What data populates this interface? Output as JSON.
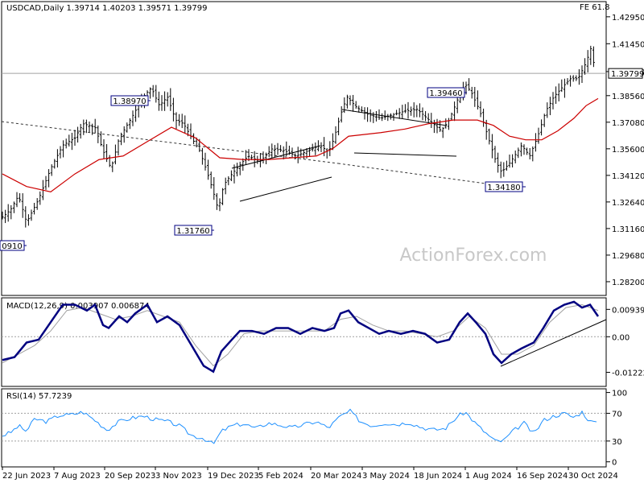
{
  "header": {
    "symbol_info": "USDCAD,Daily  1.39714 1.40203 1.39571 1.39799",
    "indicator": "FE 61.8"
  },
  "watermark": "ActionForex.com",
  "colors": {
    "price_bars": "#000000",
    "ma": "#cc0000",
    "macd_main": "#000080",
    "macd_signal": "#a0a0a0",
    "rsi": "#1e90ff",
    "levels": "#a0a0a0",
    "label_border": "#000080",
    "watermark": "#c8c8c8"
  },
  "chart_data": [
    {
      "type": "line",
      "name": "price-panel",
      "title": "USDCAD,Daily",
      "ylim": [
        1.2748,
        1.4375
      ],
      "yticks": [
        "1.42950",
        "1.41450",
        "1.39900",
        "1.38560",
        "1.37080",
        "1.35600",
        "1.34120",
        "1.32640",
        "1.31160",
        "1.29680",
        "1.28200"
      ],
      "ytick_values": [
        1.4295,
        1.4145,
        1.399,
        1.3856,
        1.3708,
        1.356,
        1.3412,
        1.3264,
        1.3116,
        1.2968,
        1.282
      ],
      "current_price_label": "1.39799",
      "current_price": 1.39799,
      "x_labels": [
        "22 Jun 2023",
        "7 Aug 2023",
        "20 Sep 2023",
        "3 Nov 2023",
        "19 Dec 2023",
        "5 Feb 2024",
        "20 Mar 2024",
        "3 May 2024",
        "18 Jun 2024",
        "1 Aug 2024",
        "16 Sep 2024",
        "30 Oct 2024"
      ],
      "close_path": [
        [
          0,
          1.318
        ],
        [
          10,
          1.322
        ],
        [
          20,
          1.33
        ],
        [
          30,
          1.315
        ],
        [
          45,
          1.328
        ],
        [
          60,
          1.345
        ],
        [
          75,
          1.358
        ],
        [
          90,
          1.362
        ],
        [
          100,
          1.37
        ],
        [
          115,
          1.368
        ],
        [
          125,
          1.355
        ],
        [
          135,
          1.345
        ],
        [
          145,
          1.362
        ],
        [
          160,
          1.373
        ],
        [
          175,
          1.385
        ],
        [
          185,
          1.39
        ],
        [
          195,
          1.38
        ],
        [
          205,
          1.385
        ],
        [
          215,
          1.372
        ],
        [
          225,
          1.37
        ],
        [
          235,
          1.362
        ],
        [
          245,
          1.355
        ],
        [
          255,
          1.342
        ],
        [
          262,
          1.332
        ],
        [
          268,
          1.322
        ],
        [
          275,
          1.336
        ],
        [
          285,
          1.342
        ],
        [
          295,
          1.347
        ],
        [
          305,
          1.352
        ],
        [
          320,
          1.349
        ],
        [
          335,
          1.356
        ],
        [
          350,
          1.355
        ],
        [
          365,
          1.352
        ],
        [
          380,
          1.355
        ],
        [
          395,
          1.358
        ],
        [
          405,
          1.354
        ],
        [
          412,
          1.362
        ],
        [
          420,
          1.375
        ],
        [
          428,
          1.385
        ],
        [
          440,
          1.379
        ],
        [
          455,
          1.375
        ],
        [
          470,
          1.373
        ],
        [
          485,
          1.375
        ],
        [
          500,
          1.377
        ],
        [
          515,
          1.378
        ],
        [
          530,
          1.372
        ],
        [
          545,
          1.366
        ],
        [
          555,
          1.372
        ],
        [
          565,
          1.383
        ],
        [
          575,
          1.392
        ],
        [
          583,
          1.387
        ],
        [
          593,
          1.377
        ],
        [
          603,
          1.363
        ],
        [
          613,
          1.349
        ],
        [
          620,
          1.343
        ],
        [
          630,
          1.348
        ],
        [
          645,
          1.358
        ],
        [
          655,
          1.352
        ],
        [
          665,
          1.363
        ],
        [
          675,
          1.377
        ],
        [
          685,
          1.385
        ],
        [
          695,
          1.39
        ],
        [
          705,
          1.395
        ],
        [
          715,
          1.395
        ],
        [
          725,
          1.404
        ],
        [
          731,
          1.412
        ],
        [
          737,
          1.398
        ]
      ],
      "ma_path": [
        [
          0,
          1.342
        ],
        [
          30,
          1.335
        ],
        [
          60,
          1.332
        ],
        [
          90,
          1.342
        ],
        [
          120,
          1.35
        ],
        [
          150,
          1.352
        ],
        [
          180,
          1.36
        ],
        [
          210,
          1.368
        ],
        [
          240,
          1.362
        ],
        [
          270,
          1.351
        ],
        [
          300,
          1.35
        ],
        [
          330,
          1.35
        ],
        [
          360,
          1.351
        ],
        [
          390,
          1.352
        ],
        [
          410,
          1.356
        ],
        [
          430,
          1.363
        ],
        [
          450,
          1.364
        ],
        [
          470,
          1.365
        ],
        [
          500,
          1.367
        ],
        [
          530,
          1.37
        ],
        [
          560,
          1.372
        ],
        [
          590,
          1.372
        ],
        [
          610,
          1.369
        ],
        [
          630,
          1.363
        ],
        [
          650,
          1.361
        ],
        [
          670,
          1.361
        ],
        [
          690,
          1.366
        ],
        [
          710,
          1.373
        ],
        [
          725,
          1.38
        ],
        [
          740,
          1.384
        ]
      ],
      "annotations": [
        {
          "label": "1.38970",
          "value": 1.3897
        },
        {
          "label": "1.31760",
          "value": 1.3176
        },
        {
          "label": "1.39460",
          "value": 1.3946
        },
        {
          "label": "1.34180",
          "value": 1.3418
        },
        {
          "label": "0910",
          "value": 1.3091
        }
      ]
    },
    {
      "type": "line",
      "name": "macd-panel",
      "title": "MACD(12,26,9) 0.003907 0.006874",
      "ylim": [
        -0.0165,
        0.0128
      ],
      "yticks": [
        "0.009391",
        "0.00",
        "-0.012225"
      ],
      "ytick_values": [
        0.009391,
        0.0,
        -0.012225
      ],
      "macd_path": [
        [
          0,
          -0.008
        ],
        [
          15,
          -0.007
        ],
        [
          30,
          -0.002
        ],
        [
          45,
          -0.001
        ],
        [
          60,
          0.005
        ],
        [
          75,
          0.011
        ],
        [
          90,
          0.011
        ],
        [
          105,
          0.009
        ],
        [
          115,
          0.011
        ],
        [
          125,
          0.004
        ],
        [
          132,
          0.003
        ],
        [
          145,
          0.007
        ],
        [
          155,
          0.005
        ],
        [
          165,
          0.008
        ],
        [
          180,
          0.011
        ],
        [
          192,
          0.005
        ],
        [
          205,
          0.007
        ],
        [
          220,
          0.004
        ],
        [
          235,
          -0.003
        ],
        [
          250,
          -0.01
        ],
        [
          262,
          -0.012
        ],
        [
          272,
          -0.005
        ],
        [
          285,
          -0.001
        ],
        [
          295,
          0.002
        ],
        [
          310,
          0.002
        ],
        [
          325,
          0.001
        ],
        [
          340,
          0.003
        ],
        [
          355,
          0.003
        ],
        [
          370,
          0.001
        ],
        [
          385,
          0.003
        ],
        [
          400,
          0.002
        ],
        [
          412,
          0.003
        ],
        [
          420,
          0.008
        ],
        [
          430,
          0.009
        ],
        [
          442,
          0.005
        ],
        [
          455,
          0.003
        ],
        [
          468,
          0.001
        ],
        [
          480,
          0.002
        ],
        [
          495,
          0.001
        ],
        [
          510,
          0.002
        ],
        [
          525,
          0.001
        ],
        [
          540,
          -0.002
        ],
        [
          555,
          -0.001
        ],
        [
          568,
          0.005
        ],
        [
          578,
          0.008
        ],
        [
          588,
          0.005
        ],
        [
          600,
          0.001
        ],
        [
          610,
          -0.006
        ],
        [
          620,
          -0.009
        ],
        [
          632,
          -0.006
        ],
        [
          645,
          -0.004
        ],
        [
          660,
          -0.002
        ],
        [
          672,
          0.003
        ],
        [
          685,
          0.009
        ],
        [
          698,
          0.011
        ],
        [
          710,
          0.012
        ],
        [
          720,
          0.01
        ],
        [
          730,
          0.011
        ],
        [
          740,
          0.007
        ]
      ],
      "signal_path": [
        [
          0,
          -0.009
        ],
        [
          20,
          -0.006
        ],
        [
          40,
          -0.003
        ],
        [
          60,
          0.002
        ],
        [
          80,
          0.009
        ],
        [
          100,
          0.01
        ],
        [
          120,
          0.008
        ],
        [
          140,
          0.006
        ],
        [
          160,
          0.007
        ],
        [
          180,
          0.009
        ],
        [
          200,
          0.007
        ],
        [
          220,
          0.005
        ],
        [
          240,
          -0.003
        ],
        [
          262,
          -0.01
        ],
        [
          280,
          -0.006
        ],
        [
          300,
          0.001
        ],
        [
          320,
          0.002
        ],
        [
          340,
          0.002
        ],
        [
          360,
          0.002
        ],
        [
          380,
          0.002
        ],
        [
          400,
          0.002
        ],
        [
          420,
          0.006
        ],
        [
          440,
          0.007
        ],
        [
          460,
          0.004
        ],
        [
          480,
          0.002
        ],
        [
          500,
          0.002
        ],
        [
          520,
          0.001
        ],
        [
          540,
          0.0
        ],
        [
          560,
          0.002
        ],
        [
          580,
          0.007
        ],
        [
          600,
          0.003
        ],
        [
          620,
          -0.006
        ],
        [
          640,
          -0.006
        ],
        [
          660,
          -0.003
        ],
        [
          680,
          0.005
        ],
        [
          700,
          0.01
        ],
        [
          720,
          0.011
        ],
        [
          740,
          0.009
        ]
      ]
    },
    {
      "type": "line",
      "name": "rsi-panel",
      "title": "RSI(14) 57.7239",
      "ylim": [
        -5,
        103
      ],
      "yticks": [
        "100",
        "70",
        "30",
        "0"
      ],
      "ytick_values": [
        100,
        70,
        30,
        0
      ],
      "rsi_path": [
        [
          0,
          38
        ],
        [
          10,
          42
        ],
        [
          20,
          52
        ],
        [
          30,
          44
        ],
        [
          40,
          62
        ],
        [
          55,
          58
        ],
        [
          70,
          67
        ],
        [
          85,
          68
        ],
        [
          100,
          72
        ],
        [
          115,
          60
        ],
        [
          130,
          46
        ],
        [
          145,
          58
        ],
        [
          160,
          63
        ],
        [
          175,
          66
        ],
        [
          190,
          61
        ],
        [
          205,
          58
        ],
        [
          220,
          52
        ],
        [
          235,
          38
        ],
        [
          250,
          34
        ],
        [
          262,
          25
        ],
        [
          272,
          44
        ],
        [
          285,
          52
        ],
        [
          300,
          55
        ],
        [
          315,
          48
        ],
        [
          330,
          56
        ],
        [
          345,
          53
        ],
        [
          360,
          49
        ],
        [
          375,
          54
        ],
        [
          390,
          58
        ],
        [
          405,
          49
        ],
        [
          420,
          66
        ],
        [
          432,
          73
        ],
        [
          445,
          58
        ],
        [
          460,
          52
        ],
        [
          475,
          56
        ],
        [
          490,
          54
        ],
        [
          505,
          57
        ],
        [
          520,
          50
        ],
        [
          535,
          46
        ],
        [
          550,
          48
        ],
        [
          565,
          65
        ],
        [
          575,
          72
        ],
        [
          588,
          55
        ],
        [
          600,
          42
        ],
        [
          612,
          30
        ],
        [
          622,
          30
        ],
        [
          635,
          45
        ],
        [
          648,
          56
        ],
        [
          660,
          40
        ],
        [
          672,
          60
        ],
        [
          685,
          66
        ],
        [
          698,
          70
        ],
        [
          710,
          64
        ],
        [
          720,
          72
        ],
        [
          730,
          58
        ],
        [
          740,
          57.7
        ]
      ]
    }
  ]
}
